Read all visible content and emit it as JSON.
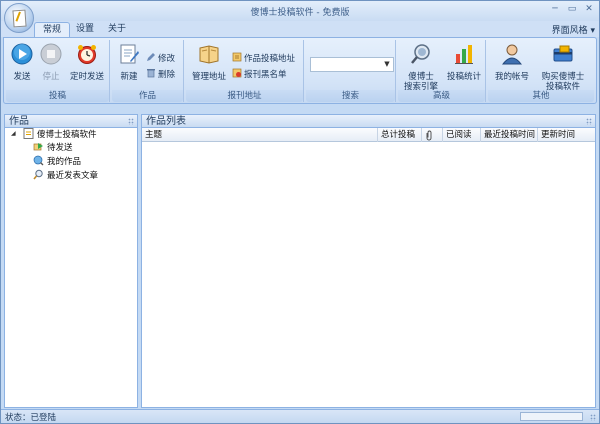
{
  "window": {
    "title": "傻博士投稿软件 - 免费版",
    "controls": {
      "minimize": "─",
      "restore": "▭",
      "close": "✕"
    }
  },
  "tabs": [
    {
      "label": "常规",
      "active": true
    },
    {
      "label": "设置",
      "active": false
    },
    {
      "label": "关于",
      "active": false
    }
  ],
  "style_menu": {
    "label": "界面风格",
    "arrow": "▾"
  },
  "ribbon": {
    "groups": {
      "tougao": {
        "label": "投稿",
        "buttons": {
          "send": "发送",
          "stop": "停止",
          "timed_send": "定时发送"
        }
      },
      "zuopin": {
        "label": "作品",
        "buttons": {
          "new": "新建",
          "edit": "修改",
          "delete": "删除"
        }
      },
      "baokan": {
        "label": "报刊地址",
        "buttons": {
          "manage": "管理地址",
          "submit_address": "作品投稿地址",
          "blacklist": "报刊黑名单"
        }
      },
      "search": {
        "label": "搜索",
        "combo_value": ""
      },
      "advanced": {
        "label": "高级",
        "buttons": {
          "search_engine_line1": "傻博士",
          "search_engine_line2": "搜索引擎",
          "stats": "投稿统计"
        }
      },
      "other": {
        "label": "其他",
        "buttons": {
          "account": "我的帐号",
          "buy_line1": "购买傻博士",
          "buy_line2": "投稿软件"
        }
      }
    }
  },
  "left_pane": {
    "title": "作品",
    "tree": {
      "root": "傻博士投稿软件",
      "children": [
        "待发送",
        "我的作品",
        "最近发表文章"
      ]
    }
  },
  "right_pane": {
    "title": "作品列表",
    "columns": [
      "主题",
      "总计投稿",
      "",
      "已阅读",
      "最近投稿时间",
      "更新时间"
    ]
  },
  "statusbar": {
    "text": "状态：已登陆"
  },
  "colors": {
    "ribbon_bg": "#d3e3f7",
    "border": "#8db2e3",
    "text": "#1e395b"
  }
}
